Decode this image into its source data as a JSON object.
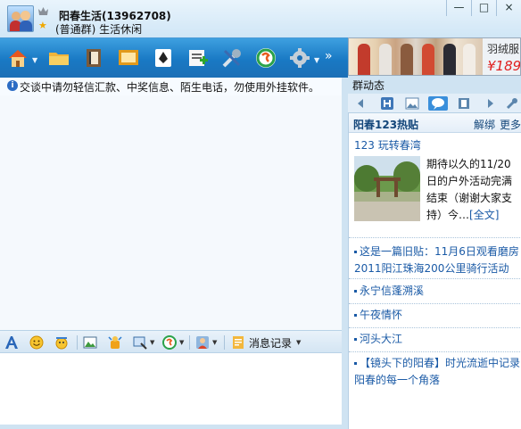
{
  "window": {
    "group_name": "阳春生活(13962708)",
    "group_subtitle": "(普通群) 生活休闲",
    "minimize": "—",
    "maximize": "□",
    "close": "×"
  },
  "toolbar": {
    "icons": [
      "home-icon",
      "folder-icon",
      "album-icon",
      "screen-icon",
      "card-game-icon",
      "add-note-icon",
      "tools-icon",
      "soso-icon",
      "settings-icon"
    ],
    "more": "»"
  },
  "notice": {
    "text": "交谈中请勿轻信汇款、中奖信息、陌生电话，勿使用外挂软件。"
  },
  "input_toolbar": {
    "icons": [
      "font-icon",
      "emoji-icon",
      "magic-emoji-icon",
      "image-icon",
      "shake-icon",
      "screenshot-icon",
      "soso-icon",
      "avatar-icon",
      "history-icon"
    ],
    "history_label": "消息记录"
  },
  "right_panel": {
    "ad": {
      "title": "羽绒服",
      "price": "¥189"
    },
    "dynamics_label": "群动态",
    "tabs": [
      "back-icon",
      "h-icon",
      "image-icon",
      "chat-icon",
      "film-icon",
      "forward-icon",
      "wrench-icon"
    ],
    "hot": {
      "title": "阳春123热贴",
      "unbind": "解绑",
      "more": "更多",
      "feature_title": "123 玩转春湾",
      "feature_desc": "期待以久的11/20日的户外活动完满结束（谢谢大家支持）今…",
      "feature_link": "[全文]",
      "items": [
        "这是一篇旧贴：11月6日观看磨房2011阳江珠海200公里骑行活动",
        "永宁信蓬溯溪",
        "午夜情怀",
        "河头大江",
        "【镜头下的阳春】时光流逝中记录阳春的每一个角落"
      ]
    }
  }
}
